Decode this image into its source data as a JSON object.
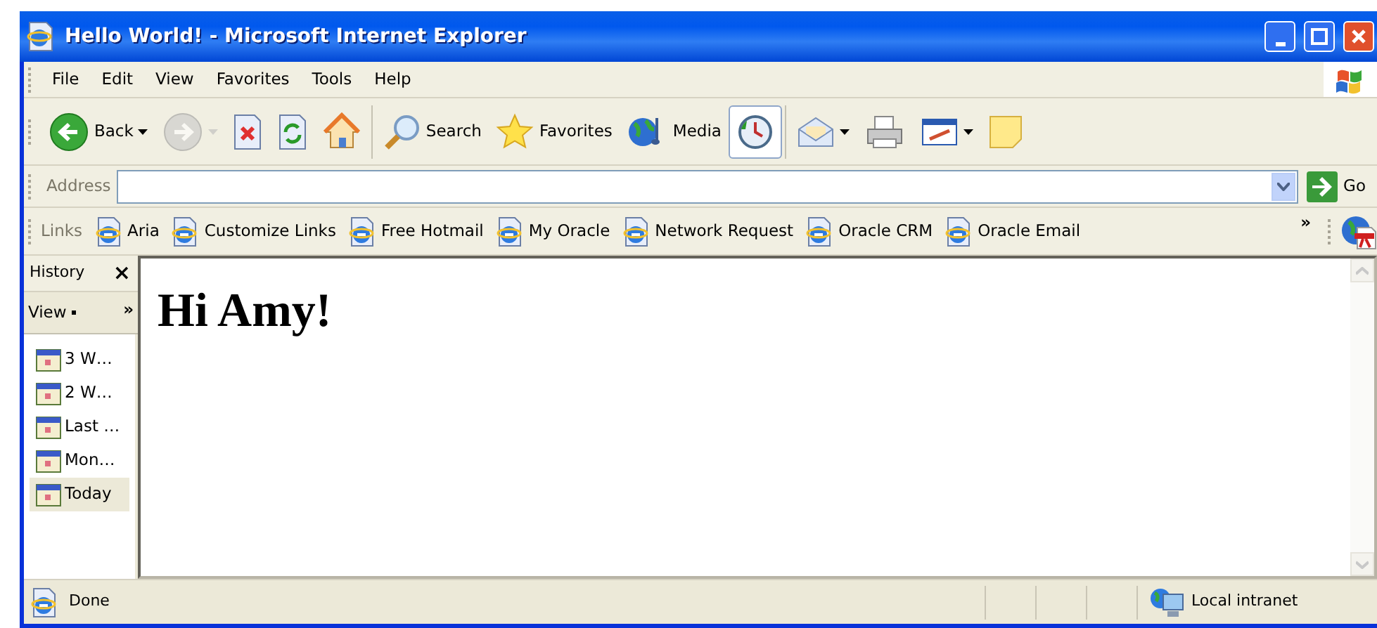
{
  "window": {
    "title": "Hello World! - Microsoft Internet Explorer"
  },
  "menu": [
    "File",
    "Edit",
    "View",
    "Favorites",
    "Tools",
    "Help"
  ],
  "toolbar": [
    {
      "kind": "back",
      "label": "Back",
      "dropdown": true,
      "disabled": false,
      "selected": false
    },
    {
      "kind": "forward",
      "dropdown": true,
      "disabled": true,
      "selected": false
    },
    {
      "kind": "stop",
      "dropdown": false,
      "disabled": false,
      "selected": false
    },
    {
      "kind": "refresh",
      "dropdown": false,
      "disabled": false,
      "selected": false
    },
    {
      "kind": "home",
      "dropdown": false,
      "disabled": false,
      "selected": false
    },
    {
      "kind": "separator"
    },
    {
      "kind": "search",
      "label": "Search",
      "dropdown": false,
      "disabled": false,
      "selected": false
    },
    {
      "kind": "favorites",
      "label": "Favorites",
      "dropdown": false,
      "disabled": false,
      "selected": false
    },
    {
      "kind": "media",
      "label": "Media",
      "dropdown": false,
      "disabled": false,
      "selected": false
    },
    {
      "kind": "history",
      "dropdown": false,
      "disabled": false,
      "selected": true
    },
    {
      "kind": "separator"
    },
    {
      "kind": "mail",
      "dropdown": true,
      "disabled": false,
      "selected": false
    },
    {
      "kind": "print",
      "dropdown": false,
      "disabled": false,
      "selected": false
    },
    {
      "kind": "edit",
      "dropdown": true,
      "disabled": false,
      "selected": false
    },
    {
      "kind": "note",
      "dropdown": false,
      "disabled": false,
      "selected": false
    }
  ],
  "address": {
    "label": "Address",
    "go": "Go"
  },
  "links": {
    "label": "Links",
    "items": [
      "Aria",
      "Customize Links",
      "Free Hotmail",
      "My Oracle",
      "Network Request",
      "Oracle CRM",
      "Oracle Email"
    ],
    "more": "»"
  },
  "sidebar": {
    "title": "History",
    "close": "×",
    "view": "View",
    "more": "»",
    "items": [
      {
        "label": "3 W…",
        "selected": false
      },
      {
        "label": "2 W…",
        "selected": false
      },
      {
        "label": "Last …",
        "selected": false
      },
      {
        "label": "Mon…",
        "selected": false
      },
      {
        "label": "Today",
        "selected": true
      }
    ]
  },
  "content": {
    "heading": "Hi Amy!"
  },
  "status_bar": {
    "text": "Done",
    "zone": "Local intranet"
  }
}
